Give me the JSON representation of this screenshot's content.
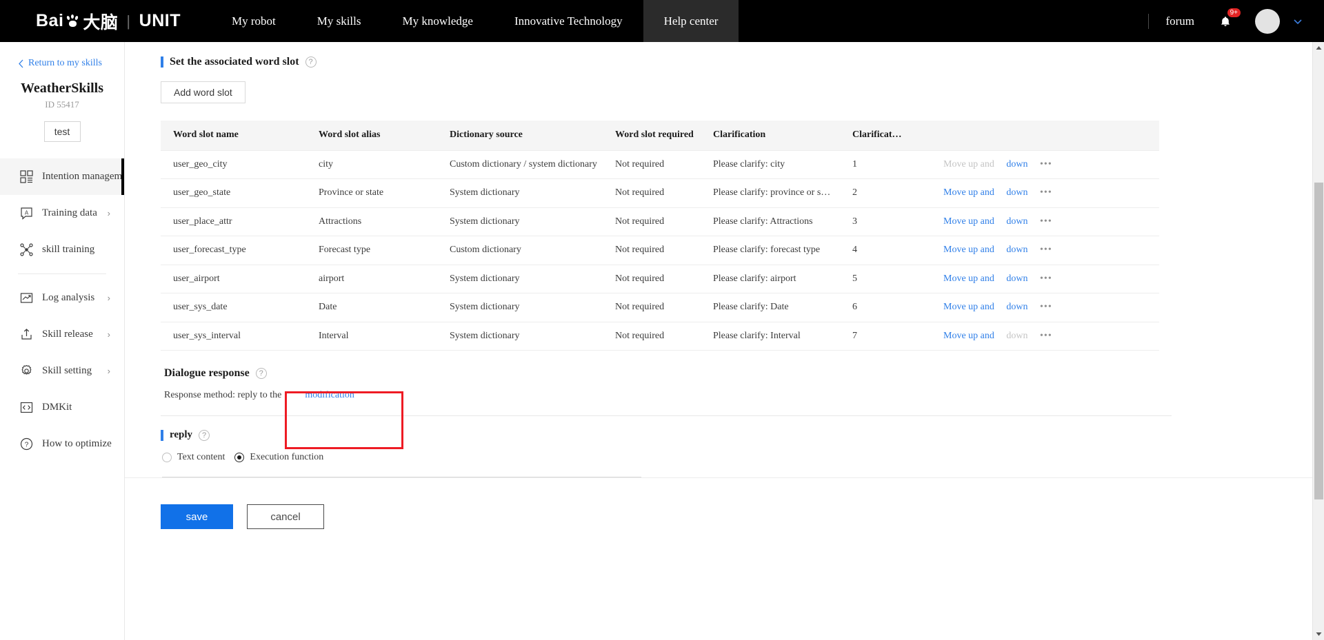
{
  "topnav": {
    "logo": {
      "baidu": "Bai",
      "brain": "大脑",
      "divider": "|",
      "unit": "UNIT"
    },
    "links": [
      {
        "label": "My robot",
        "active": false
      },
      {
        "label": "My skills",
        "active": false
      },
      {
        "label": "My knowledge",
        "active": false
      },
      {
        "label": "Innovative Technology",
        "active": false
      },
      {
        "label": "Help center",
        "active": true
      }
    ],
    "forum": "forum",
    "notification_badge": "9+"
  },
  "sidebar": {
    "return_label": "Return to my skills",
    "skill_name": "WeatherSkills",
    "skill_id": "ID 55417",
    "test_button": "test",
    "items": [
      {
        "label": "Intention management",
        "icon": "grid-icon",
        "active": true,
        "arrow": ""
      },
      {
        "label": "Training data",
        "icon": "annotation-icon",
        "active": false,
        "arrow": "›"
      },
      {
        "label": "skill training",
        "icon": "model-icon",
        "active": false,
        "arrow": ""
      },
      {
        "label": "Log analysis",
        "icon": "chart-icon",
        "active": false,
        "arrow": "›"
      },
      {
        "label": "Skill release",
        "icon": "upload-icon",
        "active": false,
        "arrow": "›"
      },
      {
        "label": "Skill setting",
        "icon": "gear-icon",
        "active": false,
        "arrow": "›"
      },
      {
        "label": "DMKit",
        "icon": "code-icon",
        "active": false,
        "arrow": ""
      },
      {
        "label": "How to optimize",
        "icon": "question-icon",
        "active": false,
        "arrow": ""
      }
    ]
  },
  "main": {
    "section_title": "Set the associated word slot",
    "add_button": "Add word slot",
    "table": {
      "columns": [
        "Word slot name",
        "Word slot alias",
        "Dictionary source",
        "Word slot required",
        "Clarification",
        "Clarificat…",
        ""
      ],
      "rows": [
        {
          "name": "user_geo_city",
          "alias": "city",
          "source": "Custom dictionary / system dictionary",
          "required": "Not required",
          "clarification": "Please clarify: city",
          "order": "1",
          "move_up": "Move up and",
          "move_down": "down",
          "move_up_disabled": true,
          "move_down_disabled": false,
          "more": "•••"
        },
        {
          "name": "user_geo_state",
          "alias": "Province or state",
          "source": "System dictionary",
          "required": "Not required",
          "clarification": "Please clarify: province or s…",
          "order": "2",
          "move_up": "Move up and",
          "move_down": "down",
          "move_up_disabled": false,
          "move_down_disabled": false,
          "more": "•••"
        },
        {
          "name": "user_place_attr",
          "alias": "Attractions",
          "source": "System dictionary",
          "required": "Not required",
          "clarification": "Please clarify: Attractions",
          "order": "3",
          "move_up": "Move up and",
          "move_down": "down",
          "move_up_disabled": false,
          "move_down_disabled": false,
          "more": "•••"
        },
        {
          "name": "user_forecast_type",
          "alias": "Forecast type",
          "source": "Custom dictionary",
          "required": "Not required",
          "clarification": "Please clarify: forecast type",
          "order": "4",
          "move_up": "Move up and",
          "move_down": "down",
          "move_up_disabled": false,
          "move_down_disabled": false,
          "more": "•••"
        },
        {
          "name": "user_airport",
          "alias": "airport",
          "source": "System dictionary",
          "required": "Not required",
          "clarification": "Please clarify: airport",
          "order": "5",
          "move_up": "Move up and",
          "move_down": "down",
          "move_up_disabled": false,
          "move_down_disabled": false,
          "more": "•••"
        },
        {
          "name": "user_sys_date",
          "alias": "Date",
          "source": "System dictionary",
          "required": "Not required",
          "clarification": "Please clarify: Date",
          "order": "6",
          "move_up": "Move up and",
          "move_down": "down",
          "move_up_disabled": false,
          "move_down_disabled": false,
          "more": "•••"
        },
        {
          "name": "user_sys_interval",
          "alias": "Interval",
          "source": "System dictionary",
          "required": "Not required",
          "clarification": "Please clarify: Interval",
          "order": "7",
          "move_up": "Move up and",
          "move_down": "down",
          "move_up_disabled": false,
          "move_down_disabled": true,
          "more": "•••"
        }
      ]
    },
    "dialogue": {
      "title": "Dialogue response",
      "method_label": "Response method: reply to the",
      "modify_link": "modification"
    },
    "reply": {
      "title": "reply",
      "options": [
        {
          "label": "Text content",
          "selected": false
        },
        {
          "label": "Execution function",
          "selected": true
        }
      ]
    },
    "footer": {
      "save": "save",
      "cancel": "cancel"
    }
  },
  "colors": {
    "accent_blue": "#2f7fe8",
    "primary_button": "#1171e8",
    "highlight_red": "#ee1b24",
    "nav_background": "#000000"
  }
}
